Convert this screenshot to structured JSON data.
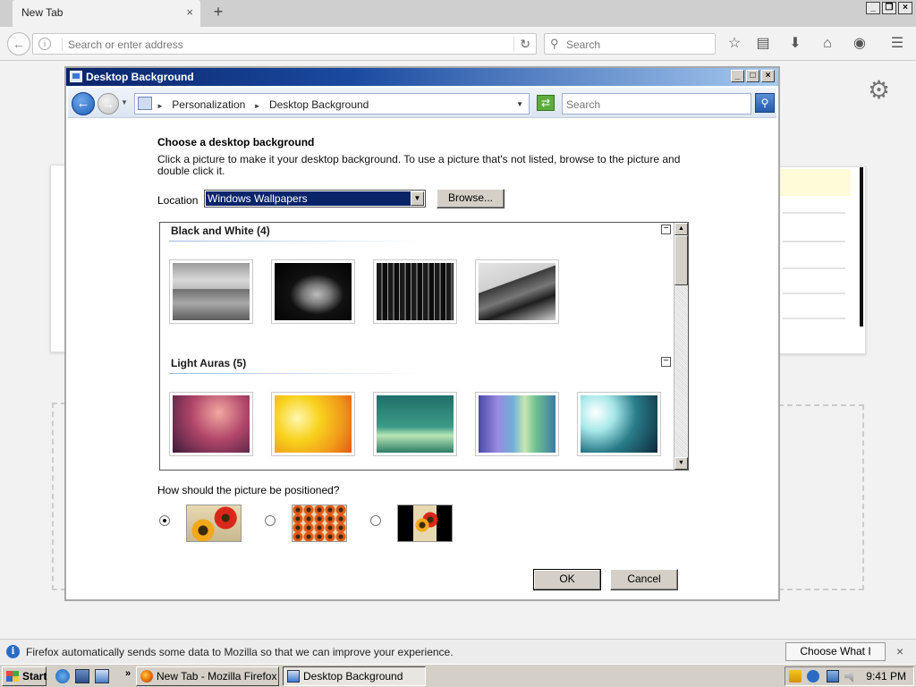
{
  "browser": {
    "tab_title": "New Tab",
    "tab_close": "×",
    "new_tab": "+",
    "url_placeholder": "Search or enter address",
    "search_placeholder": "Search",
    "window_buttons": [
      "_",
      "❐",
      "×"
    ]
  },
  "notification": {
    "message": "Firefox automatically sends some data to Mozilla so that we can improve your experience.",
    "button": "Choose What I Share",
    "close": "×"
  },
  "dialog": {
    "title": "Desktop Background",
    "breadcrumb": [
      "Personalization",
      "Desktop Background"
    ],
    "search_placeholder": "Search",
    "heading": "Choose a desktop background",
    "description": "Click a picture to make it your desktop background. To use a picture that's not listed, browse to the picture and double click it.",
    "location_label": "Location",
    "location_value": "Windows Wallpapers",
    "browse_button": "Browse...",
    "groups": [
      {
        "title": "Black and White (4)",
        "collapse": "−"
      },
      {
        "title": "Light Auras (5)",
        "collapse": "−"
      }
    ],
    "position_question": "How should the picture be positioned?",
    "position_selected": "fit",
    "ok": "OK",
    "cancel": "Cancel"
  },
  "taskbar": {
    "start": "Start",
    "more": "»",
    "tasks": [
      {
        "label": "New Tab - Mozilla Firefox",
        "active": false
      },
      {
        "label": "Desktop Background",
        "active": true
      }
    ],
    "clock": "9:41 PM"
  }
}
